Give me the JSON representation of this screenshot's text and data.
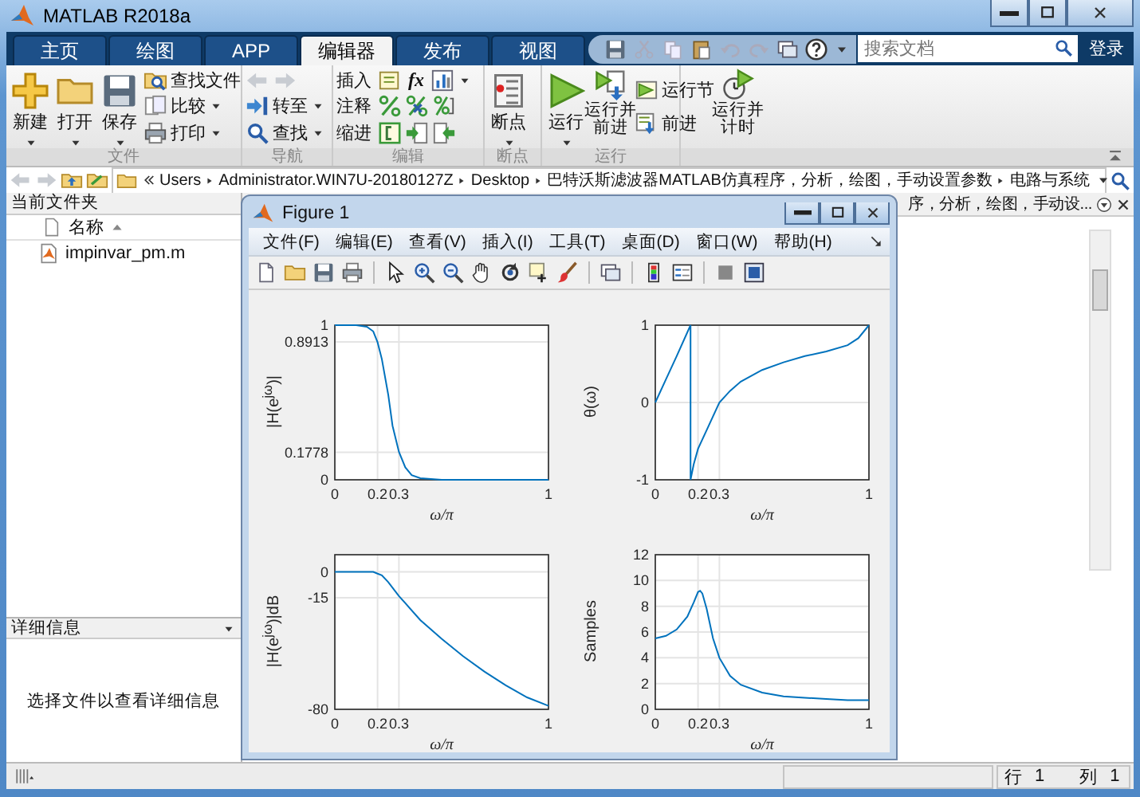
{
  "window": {
    "title": "MATLAB R2018a"
  },
  "tabs": [
    {
      "label": "主页",
      "selected": false
    },
    {
      "label": "绘图",
      "selected": false
    },
    {
      "label": "APP",
      "selected": false
    },
    {
      "label": "编辑器",
      "selected": true
    },
    {
      "label": "发布",
      "selected": false
    },
    {
      "label": "视图",
      "selected": false
    }
  ],
  "search": {
    "placeholder": "搜索文档"
  },
  "login_button": "登录",
  "ribbon": {
    "file": {
      "label": "文件",
      "new": "新建",
      "open": "打开",
      "save": "保存",
      "find_files": "查找文件",
      "compare": "比较",
      "print": "打印"
    },
    "navigate": {
      "label": "导航",
      "go_to": "转至",
      "find": "查找"
    },
    "edit": {
      "label": "编辑",
      "insert": "插入",
      "function_symbol": "fx",
      "comment": "注释",
      "indent": "缩进"
    },
    "breakpoints": {
      "label": "断点",
      "breakpoints": "断点"
    },
    "run": {
      "label": "运行",
      "run": "运行",
      "run_and_advance": "运行并前进",
      "run_section": "运行节",
      "advance": "前进",
      "run_and_time": "运行并计时"
    }
  },
  "address_bar": {
    "path": [
      "Users",
      "Administrator.WIN7U-20180127Z",
      "Desktop",
      "巴特沃斯滤波器MATLAB仿真程序，分析，绘图，手动设置参数",
      "电路与系统"
    ]
  },
  "current_folder": {
    "title": "当前文件夹",
    "column": "名称",
    "files": [
      "impinvar_pm.m"
    ]
  },
  "details": {
    "title": "详细信息",
    "message": "选择文件以查看详细信息"
  },
  "editor": {
    "title": "序，分析，绘图，手动设..."
  },
  "figure": {
    "title": "Figure 1",
    "menu": [
      "文件(F)",
      "编辑(E)",
      "查看(V)",
      "插入(I)",
      "工具(T)",
      "桌面(D)",
      "窗口(W)",
      "帮助(H)"
    ],
    "plots": [
      {
        "chart_data": {
          "type": "line",
          "xlabel": "ω/π",
          "ylabel": "|H(e$^{jω}$)|",
          "xlim": [
            0,
            1
          ],
          "ylim": [
            0,
            1
          ],
          "xticks": [
            0,
            0.2,
            0.3,
            1
          ],
          "yticks": [
            0,
            {
              "value": 0.1778,
              "label": "0.1778"
            },
            {
              "value": 0.8913,
              "label": "0.8913"
            },
            1
          ],
          "x": [
            0,
            0.05,
            0.1,
            0.15,
            0.18,
            0.2,
            0.22,
            0.25,
            0.27,
            0.3,
            0.33,
            0.36,
            0.4,
            0.5,
            0.6,
            0.8,
            1
          ],
          "values": [
            1,
            1,
            1,
            0.99,
            0.96,
            0.89,
            0.78,
            0.55,
            0.35,
            0.18,
            0.08,
            0.03,
            0.01,
            0,
            0,
            0,
            0
          ],
          "grid": true
        }
      },
      {
        "chart_data": {
          "type": "line",
          "xlabel": "ω/π",
          "ylabel": "θ(ω)",
          "xlim": [
            0,
            1
          ],
          "ylim": [
            -1,
            1
          ],
          "xticks": [
            0,
            0.2,
            0.3,
            1
          ],
          "yticks": [
            -1,
            0,
            1
          ],
          "x": [
            0,
            0.05,
            0.1,
            0.165,
            0.165,
            0.18,
            0.2,
            0.25,
            0.3,
            0.35,
            0.4,
            0.5,
            0.6,
            0.7,
            0.8,
            0.9,
            0.95,
            1
          ],
          "values": [
            0,
            0.3,
            0.6,
            1,
            -1,
            -0.8,
            -0.6,
            -0.3,
            0,
            0.15,
            0.27,
            0.42,
            0.52,
            0.6,
            0.66,
            0.74,
            0.83,
            1
          ],
          "grid": true
        }
      },
      {
        "chart_data": {
          "type": "line",
          "xlabel": "ω/π",
          "ylabel": "|H(e$^{jω}$)|dB",
          "xlim": [
            0,
            1
          ],
          "ylim": [
            -80,
            10
          ],
          "xticks": [
            0,
            0.2,
            0.3,
            1
          ],
          "yticks": [
            -80,
            -15,
            0
          ],
          "x": [
            0,
            0.1,
            0.18,
            0.2,
            0.22,
            0.25,
            0.3,
            0.4,
            0.5,
            0.6,
            0.7,
            0.8,
            0.9,
            1
          ],
          "values": [
            0,
            0,
            0,
            -1,
            -2,
            -6,
            -14,
            -28,
            -39,
            -49,
            -58,
            -66,
            -73,
            -78
          ],
          "grid": true
        }
      },
      {
        "chart_data": {
          "type": "line",
          "xlabel": "ω/π",
          "ylabel": "Samples",
          "xlim": [
            0,
            1
          ],
          "ylim": [
            0,
            12
          ],
          "xticks": [
            0,
            0.2,
            0.3,
            1
          ],
          "yticks": [
            0,
            2,
            4,
            6,
            8,
            10,
            12
          ],
          "x": [
            0,
            0.05,
            0.1,
            0.15,
            0.18,
            0.2,
            0.21,
            0.22,
            0.24,
            0.27,
            0.3,
            0.35,
            0.4,
            0.5,
            0.6,
            0.7,
            0.8,
            0.9,
            1
          ],
          "values": [
            5.5,
            5.7,
            6.2,
            7.2,
            8.3,
            9.1,
            9.2,
            9,
            7.8,
            5.5,
            4,
            2.6,
            1.9,
            1.3,
            1,
            0.9,
            0.8,
            0.7,
            0.7
          ],
          "grid": true
        }
      }
    ]
  },
  "status_bar": {
    "line_label": "行",
    "line": "1",
    "column_label": "列",
    "column": "1"
  }
}
